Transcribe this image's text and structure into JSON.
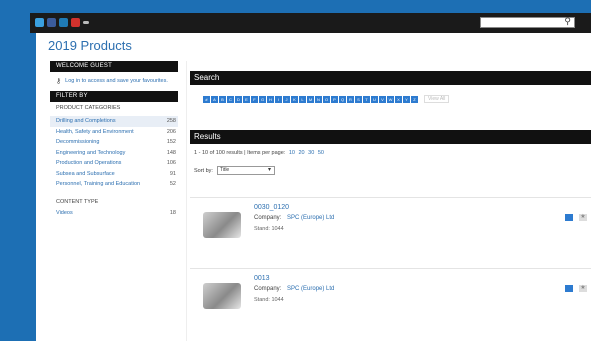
{
  "topbar": {
    "social_icons": [
      "twitter-icon",
      "facebook-icon",
      "linkedin-icon",
      "youtube-icon",
      "more-icon"
    ],
    "search_icon": "search-icon"
  },
  "page": {
    "title": "2019 Products"
  },
  "sidebar": {
    "welcome_header": "WELCOME GUEST",
    "login_text": "Log in to access and save your favourites.",
    "filter_header": "FILTER BY",
    "categories_label": "PRODUCT CATEGORIES",
    "categories": [
      {
        "label": "Drilling and Completions",
        "count": "258"
      },
      {
        "label": "Health, Safety and Environment",
        "count": "206"
      },
      {
        "label": "Decommissioning",
        "count": "152"
      },
      {
        "label": "Engineering and Technology",
        "count": "148"
      },
      {
        "label": "Production and Operations",
        "count": "106"
      },
      {
        "label": "Subsea and Subsurface",
        "count": "91"
      },
      {
        "label": "Personnel, Training and Education",
        "count": "52"
      }
    ],
    "content_type_label": "CONTENT TYPE",
    "content_types": [
      {
        "label": "Videos",
        "count": "18"
      }
    ]
  },
  "search": {
    "header": "Search",
    "letters": [
      "#",
      "A",
      "B",
      "C",
      "D",
      "E",
      "F",
      "G",
      "H",
      "I",
      "J",
      "K",
      "L",
      "M",
      "N",
      "O",
      "P",
      "Q",
      "R",
      "S",
      "T",
      "U",
      "V",
      "W",
      "X",
      "Y",
      "Z"
    ],
    "view_all": "View All"
  },
  "results": {
    "header": "Results",
    "info": "1 - 10 of 100 results | Items per page:",
    "per_page": [
      "10",
      "20",
      "30",
      "50"
    ],
    "sort_label": "Sort by:",
    "sort_value": "Title",
    "items": [
      {
        "title": "0030_0120",
        "company_label": "Company:",
        "company": "SPC (Europe) Ltd",
        "stand_label": "Stand:",
        "stand": "1044"
      },
      {
        "title": "0013",
        "company_label": "Company:",
        "company": "SPC (Europe) Ltd",
        "stand_label": "Stand:",
        "stand": "1044"
      }
    ]
  }
}
